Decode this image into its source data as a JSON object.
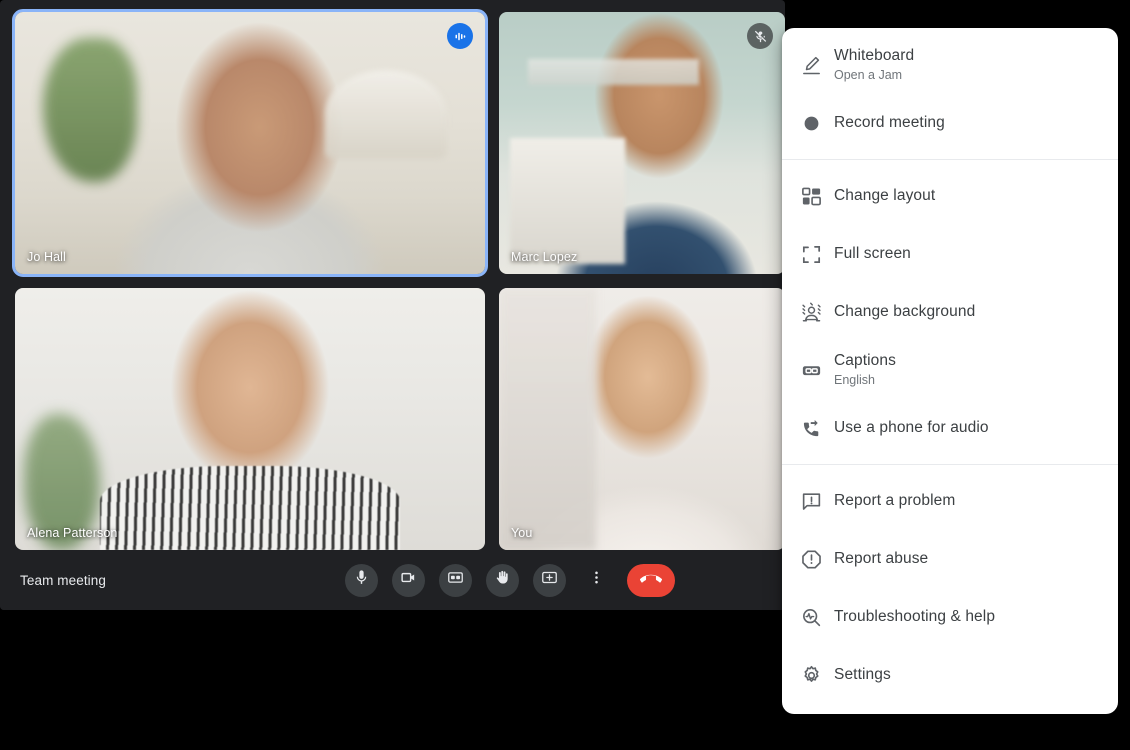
{
  "app": {
    "meeting_title": "Team meeting",
    "background_color": "#202124",
    "accent_blue": "#1a73e8",
    "active_border": "#8ab4f8",
    "hangup_red": "#ea4335"
  },
  "tiles": [
    {
      "name": "Jo Hall",
      "badge": "audio-level-icon",
      "active": true
    },
    {
      "name": "Marc Lopez",
      "badge": "mic-off-icon",
      "active": false
    },
    {
      "name": "Alena Patterson",
      "badge": "",
      "active": false
    },
    {
      "name": "You",
      "badge": "",
      "active": false
    }
  ],
  "controls": [
    {
      "name": "microphone-button",
      "icon": "microphone-icon"
    },
    {
      "name": "camera-button",
      "icon": "video-camera-icon"
    },
    {
      "name": "captions-button",
      "icon": "closed-caption-icon"
    },
    {
      "name": "raise-hand-button",
      "icon": "raised-hand-icon"
    },
    {
      "name": "present-button",
      "icon": "present-screen-icon"
    },
    {
      "name": "more-options-button",
      "icon": "more-vertical-icon"
    },
    {
      "name": "leave-call-button",
      "icon": "hang-up-icon"
    }
  ],
  "menu": {
    "groups": [
      {
        "items": [
          {
            "label": "Whiteboard",
            "sub": "Open a Jam",
            "icon": "whiteboard-pen-icon"
          },
          {
            "label": "Record meeting",
            "sub": "",
            "icon": "record-dot-icon"
          }
        ]
      },
      {
        "items": [
          {
            "label": "Change layout",
            "sub": "",
            "icon": "layout-grid-icon"
          },
          {
            "label": "Full screen",
            "sub": "",
            "icon": "fullscreen-icon"
          },
          {
            "label": "Change background",
            "sub": "",
            "icon": "change-background-icon"
          },
          {
            "label": "Captions",
            "sub": "English",
            "icon": "closed-caption-icon"
          },
          {
            "label": "Use a phone for audio",
            "sub": "",
            "icon": "phone-forward-icon"
          }
        ]
      },
      {
        "items": [
          {
            "label": "Report a problem",
            "sub": "",
            "icon": "feedback-icon"
          },
          {
            "label": "Report abuse",
            "sub": "",
            "icon": "report-abuse-icon"
          },
          {
            "label": "Troubleshooting & help",
            "sub": "",
            "icon": "troubleshoot-icon"
          },
          {
            "label": "Settings",
            "sub": "",
            "icon": "gear-icon"
          }
        ]
      }
    ]
  }
}
